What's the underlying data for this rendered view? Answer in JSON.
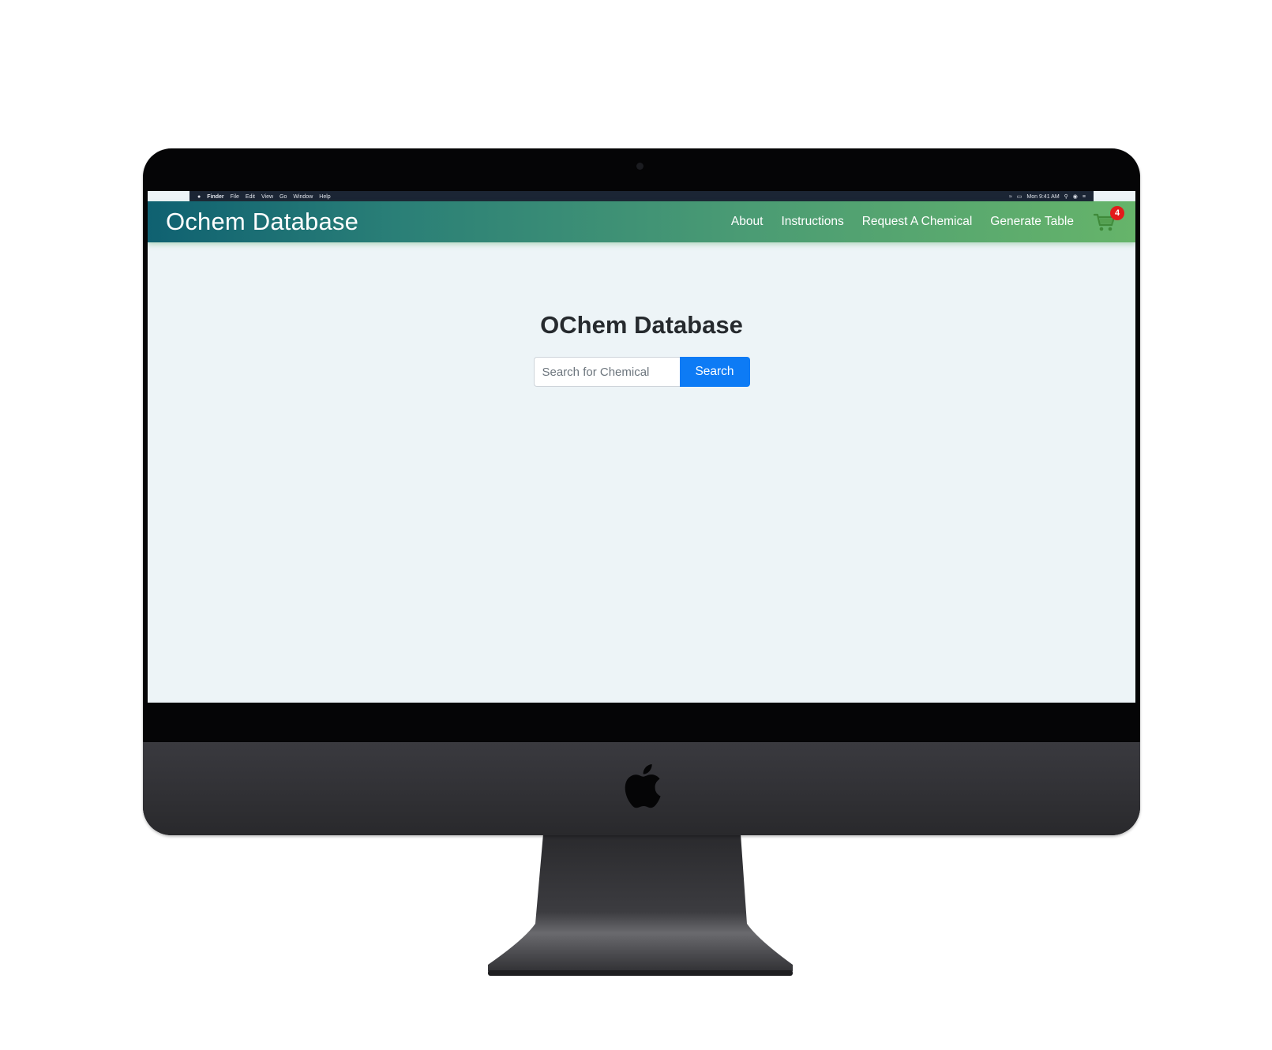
{
  "mac_menubar": {
    "left_items": [
      "Finder",
      "File",
      "Edit",
      "View",
      "Go",
      "Window",
      "Help"
    ],
    "right_text": "Mon 9:41 AM"
  },
  "navbar": {
    "brand": "Ochem Database",
    "links": [
      {
        "label": "About"
      },
      {
        "label": "Instructions"
      },
      {
        "label": "Request A Chemical"
      },
      {
        "label": "Generate Table"
      }
    ],
    "cart": {
      "icon": "cart-icon",
      "count": "4"
    }
  },
  "main": {
    "title": "OChem Database",
    "search": {
      "placeholder": "Search for Chemical",
      "value": "",
      "button_label": "Search"
    }
  },
  "colors": {
    "nav_gradient_start": "#0f6171",
    "nav_gradient_end": "#66b46a",
    "page_bg": "#edf4f7",
    "primary_button": "#0d7bf5",
    "badge": "#e31b1b"
  }
}
